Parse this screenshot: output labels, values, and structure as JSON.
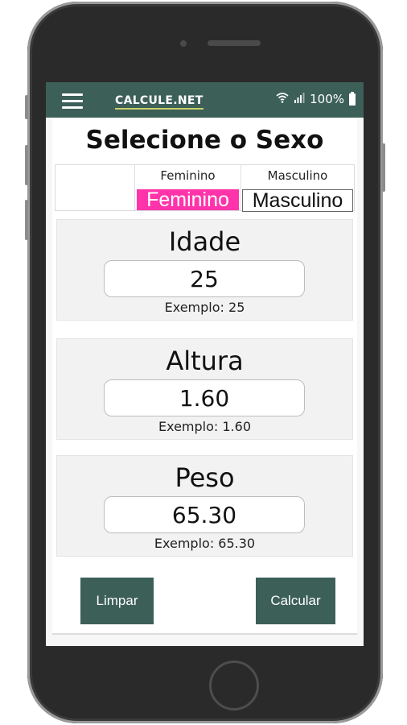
{
  "app": {
    "title": "CALCULE.NET",
    "battery": "100%"
  },
  "page": {
    "heading": "Selecione o Sexo"
  },
  "sex": {
    "female_small": "Feminino",
    "male_small": "Masculino",
    "female_button": "Feminino",
    "male_button": "Masculino",
    "selected": "Feminino",
    "selected_color": "#ff33aa"
  },
  "fields": {
    "age": {
      "label": "Idade",
      "value": "25",
      "hint": "Exemplo: 25"
    },
    "height": {
      "label": "Altura",
      "value": "1.60",
      "hint": "Exemplo: 1.60"
    },
    "weight": {
      "label": "Peso",
      "value": "65.30",
      "hint": "Exemplo: 65.30"
    }
  },
  "actions": {
    "clear_label": "Limpar",
    "calculate_label": "Calcular"
  },
  "colors": {
    "accent": "#3c5f58",
    "female": "#ff33aa"
  },
  "icons": [
    "menu-icon",
    "wifi-icon",
    "signal-icon",
    "battery-icon"
  ]
}
